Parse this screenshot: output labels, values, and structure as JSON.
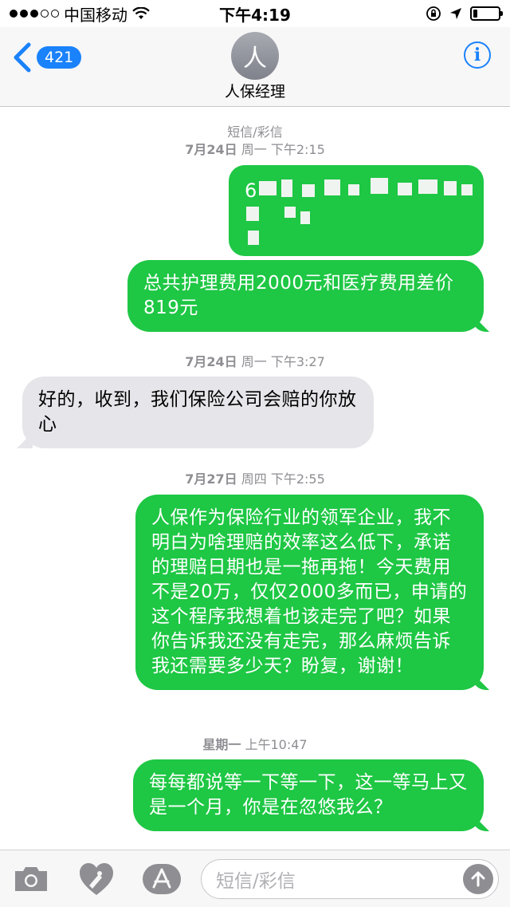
{
  "status": {
    "carrier": "中国移动",
    "time": "下午4:19"
  },
  "header": {
    "back_badge": "421",
    "avatar_initial": "人",
    "contact_name": "人保经理",
    "info_label": "i"
  },
  "messages": {
    "channel_label": "短信/彩信",
    "ts1": "7月24日 周一 下午2:15",
    "ts1_date": "7月24日",
    "ts1_rest": " 周一 下午2:15",
    "redacted_prefix": "6",
    "bubble1": "总共护理费用2000元和医疗费用差价819元",
    "ts2_date": "7月24日",
    "ts2_rest": " 周一 下午3:27",
    "bubble2": "好的，收到，我们保险公司会赔的你放心",
    "ts3_date": "7月27日",
    "ts3_rest": " 周四 下午2:55",
    "bubble3": "人保作为保险行业的领军企业，我不明白为啥理赔的效率这么低下，承诺的理赔日期也是一拖再拖！今天费用不是20万，仅仅2000多而已，申请的这个程序我想着也该走完了吧？如果你告诉我还没有走完，那么麻烦告诉我还需要多少天？盼复，谢谢！",
    "ts4_date": "星期一",
    "ts4_rest": " 上午10:47",
    "bubble4": "每每都说等一下等一下，这一等马上又是一个月，你是在忽悠我么？"
  },
  "compose": {
    "placeholder": "短信/彩信"
  },
  "colors": {
    "accent": "#1a82fb",
    "sms_green": "#1ec744",
    "incoming_gray": "#e5e5ea"
  }
}
